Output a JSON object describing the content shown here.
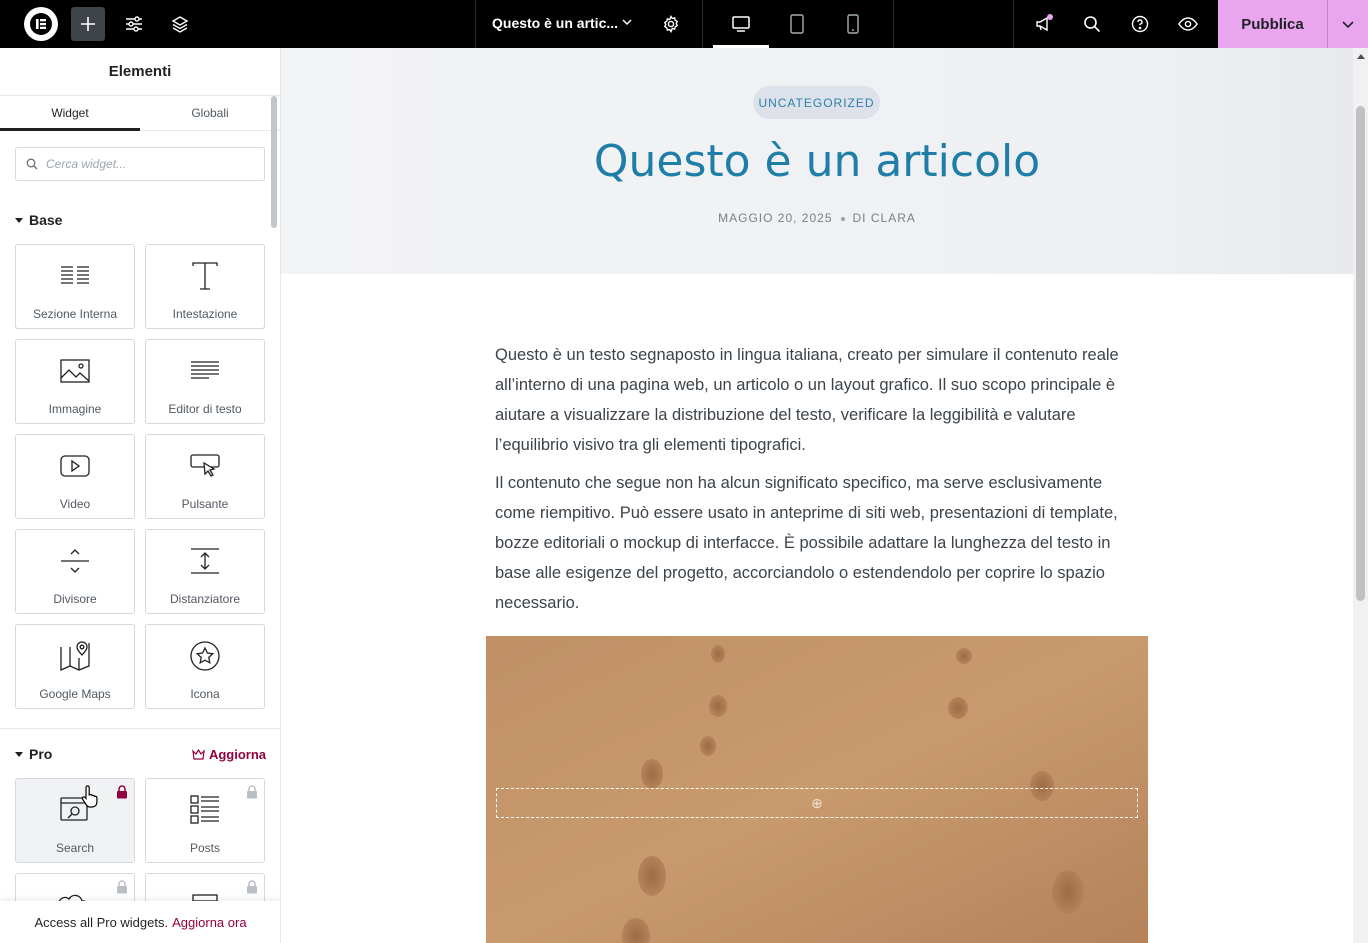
{
  "topbar": {
    "page_title": "Questo è un artic...",
    "publish_label": "Pubblica",
    "colors": {
      "bg": "#000000",
      "publish": "#e9a6ef"
    }
  },
  "panel": {
    "title": "Elementi",
    "tabs": [
      {
        "label": "Widget",
        "active": true
      },
      {
        "label": "Globali",
        "active": false
      }
    ],
    "search_placeholder": "Cerca widget...",
    "base": {
      "title": "Base",
      "widgets": [
        {
          "label": "Sezione Interna",
          "icon": "inner-section-icon"
        },
        {
          "label": "Intestazione",
          "icon": "heading-icon"
        },
        {
          "label": "Immagine",
          "icon": "image-icon"
        },
        {
          "label": "Editor di testo",
          "icon": "text-editor-icon"
        },
        {
          "label": "Video",
          "icon": "video-icon"
        },
        {
          "label": "Pulsante",
          "icon": "button-icon"
        },
        {
          "label": "Divisore",
          "icon": "divider-icon"
        },
        {
          "label": "Distanziatore",
          "icon": "spacer-icon"
        },
        {
          "label": "Google Maps",
          "icon": "google-maps-icon"
        },
        {
          "label": "Icona",
          "icon": "star-icon"
        }
      ]
    },
    "pro": {
      "title": "Pro",
      "upgrade_label": "Aggiorna",
      "widgets": [
        {
          "label": "Search",
          "icon": "search-widget-icon"
        },
        {
          "label": "Posts",
          "icon": "posts-icon"
        }
      ]
    },
    "footer": {
      "text": "Access all Pro widgets.",
      "link": "Aggiorna ora"
    }
  },
  "post": {
    "category": "UNCATEGORIZED",
    "title": "Questo è un articolo",
    "date": "MAGGIO 20, 2025",
    "author": "DI CLARA",
    "paragraphs": [
      "Questo è un testo segnaposto in lingua italiana, creato per simulare il contenuto reale all’interno di una pagina web, un articolo o un layout grafico. Il suo scopo principale è aiutare a visualizzare la distribuzione del testo, verificare la leggibilità e valutare l’equilibrio visivo tra gli elementi tipografici.",
      "Il contenuto che segue non ha alcun significato specifico, ma serve esclusivamente come riempitivo. Può essere usato in anteprime di siti web, presentazioni di template, bozze editoriali o mockup di interfacce. È possibile adattare la lunghezza del testo in base alle esigenze del progetto, accorciandolo o estendendolo per coprire lo spazio necessario."
    ],
    "colors": {
      "title": "#1f7ea8",
      "badge_bg": "#dde2ea"
    }
  }
}
